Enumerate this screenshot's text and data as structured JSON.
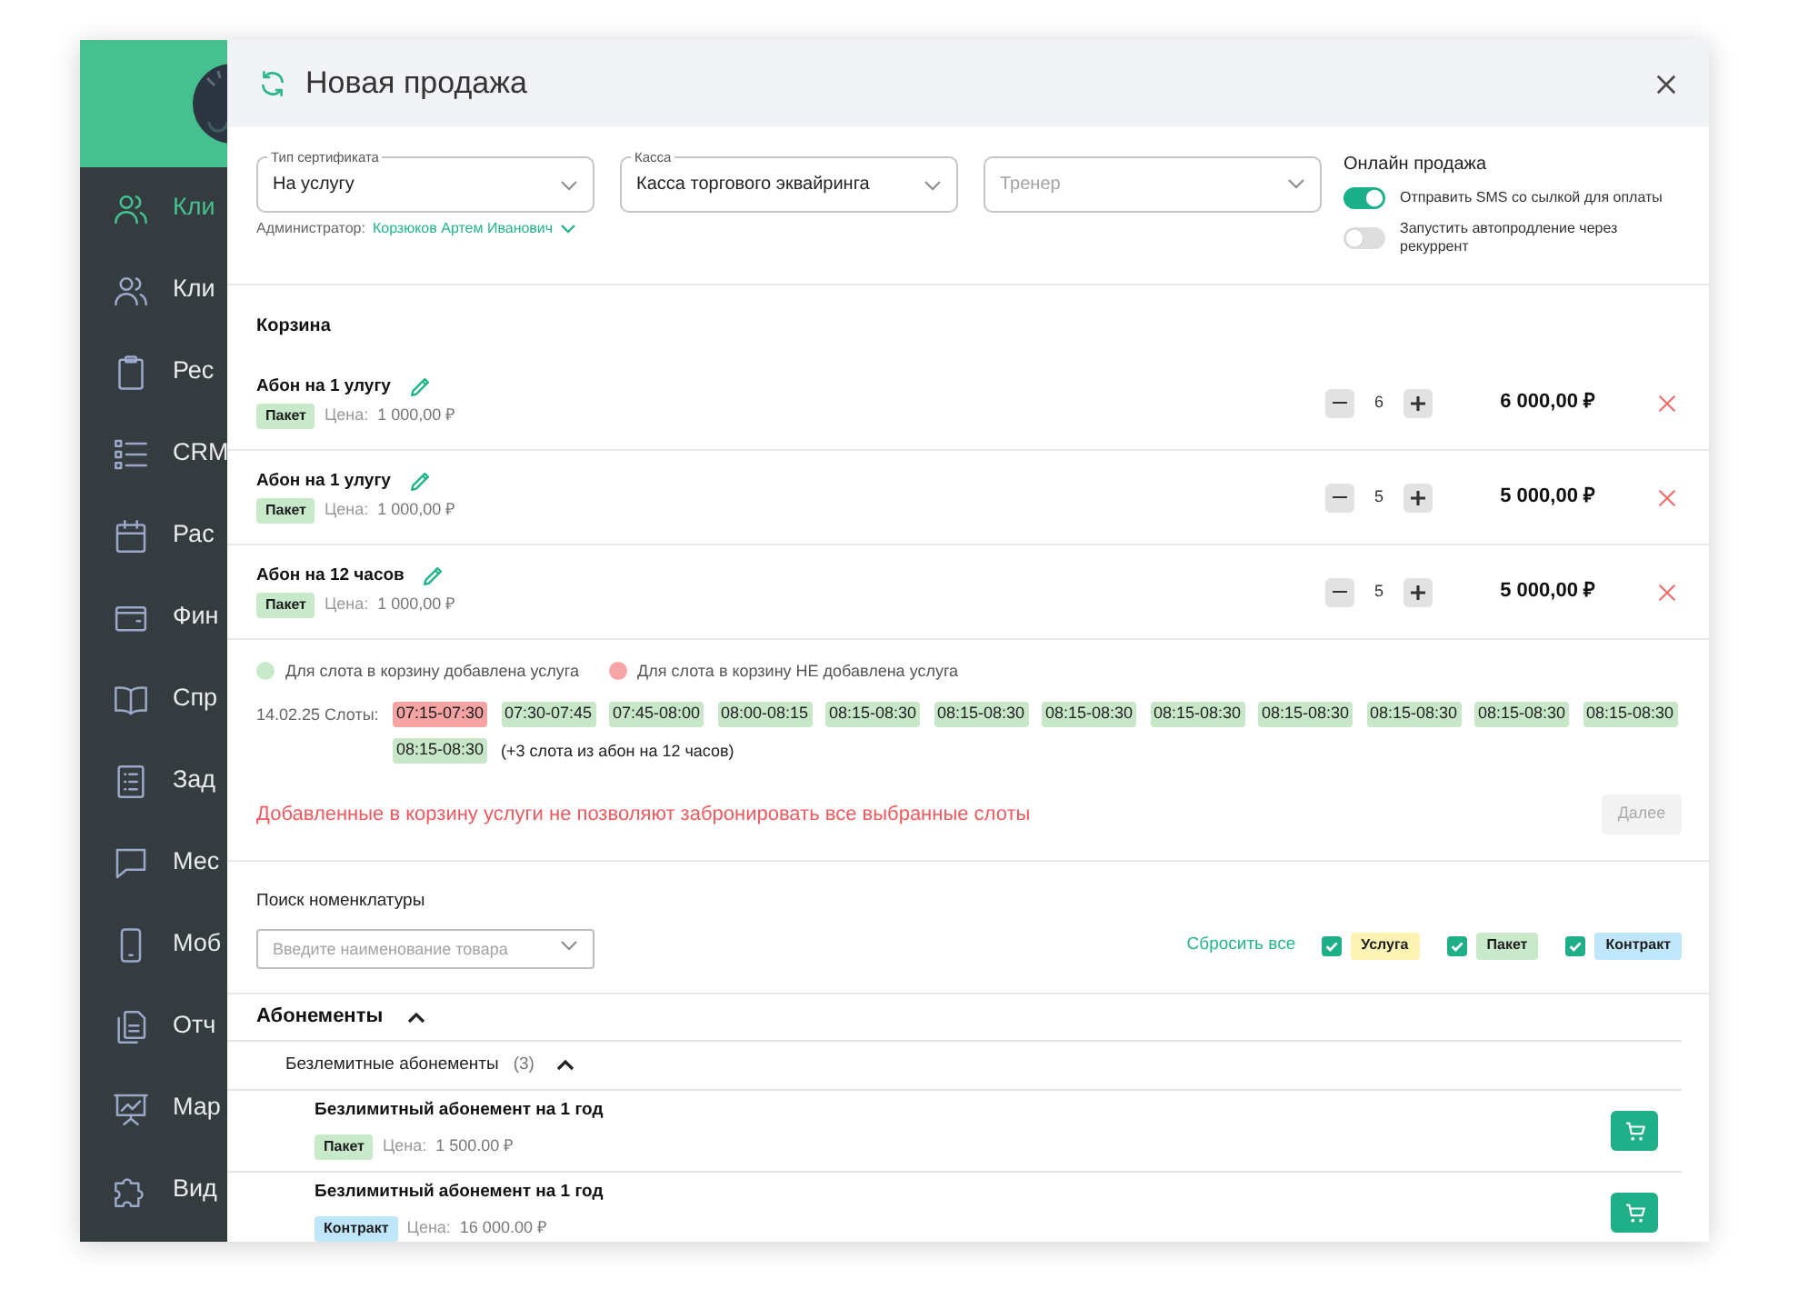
{
  "sidebar": {
    "items": [
      {
        "label": "Кли",
        "selected": true
      },
      {
        "label": "Кли",
        "selected": false
      },
      {
        "label": "Рес",
        "selected": false
      },
      {
        "label": "CRM",
        "selected": false
      },
      {
        "label": "Рас",
        "selected": false
      },
      {
        "label": "Фин",
        "selected": false
      },
      {
        "label": "Спр",
        "selected": false
      },
      {
        "label": "Зад",
        "selected": false
      },
      {
        "label": "Мес",
        "selected": false
      },
      {
        "label": "Моб",
        "selected": false
      },
      {
        "label": "Отч",
        "selected": false
      },
      {
        "label": "Мар",
        "selected": false
      },
      {
        "label": "Вид",
        "selected": false
      }
    ]
  },
  "dialog": {
    "title": "Новая продажа"
  },
  "form": {
    "fields": [
      {
        "label": "Тип сертификата",
        "value": "На услугу"
      },
      {
        "label": "Касса",
        "value": "Касса торгового эквайринга"
      },
      {
        "placeholder": "Тренер"
      }
    ],
    "administrator": {
      "label": "Администратор:",
      "value": "Корзюков Артем Иванович"
    },
    "online_sale": {
      "title": "Онлайн продажа",
      "options": [
        {
          "label": "Отправить SMS со сылкой для оплаты",
          "on": true
        },
        {
          "label": "Запустить автопродление через рекуррент",
          "on": false
        }
      ]
    }
  },
  "cart": {
    "title": "Корзина",
    "items": [
      {
        "name": "Абон на 1 улугу",
        "tag": {
          "label": "Пакет",
          "color": "#c9e9cb"
        },
        "price_label": "Цена:",
        "price": "1 000,00 ₽",
        "quantity": "6",
        "total": "6 000,00 ₽"
      },
      {
        "name": "Абон на 1 улугу",
        "tag": {
          "label": "Пакет",
          "color": "#c9e9cb"
        },
        "price_label": "Цена:",
        "price": "1 000,00 ₽",
        "quantity": "5",
        "total": "5 000,00 ₽"
      },
      {
        "name": "Абон на 12 часов",
        "tag": {
          "label": "Пакет",
          "color": "#c9e9cb"
        },
        "price_label": "Цена:",
        "price": "1 000,00 ₽",
        "quantity": "5",
        "total": "5 000,00 ₽"
      }
    ]
  },
  "slots": {
    "legend": [
      {
        "label": "Для слота в корзину добавлена услуга",
        "color": "#c9e9cb"
      },
      {
        "label": "Для слота в корзину НЕ добавлена услуга",
        "color": "#f7a4a4"
      }
    ],
    "date_label": "14.02.25 Слоты:",
    "items": [
      {
        "time": "07:15-07:30",
        "added": false
      },
      {
        "time": "07:30-07:45",
        "added": true
      },
      {
        "time": "07:45-08:00",
        "added": true
      },
      {
        "time": "08:00-08:15",
        "added": true
      },
      {
        "time": "08:15-08:30",
        "added": true
      },
      {
        "time": "08:15-08:30",
        "added": true
      },
      {
        "time": "08:15-08:30",
        "added": true
      },
      {
        "time": "08:15-08:30",
        "added": true
      },
      {
        "time": "08:15-08:30",
        "added": true
      },
      {
        "time": "08:15-08:30",
        "added": true
      },
      {
        "time": "08:15-08:30",
        "added": true
      },
      {
        "time": "08:15-08:30",
        "added": true
      },
      {
        "time": "08:15-08:30",
        "added": true
      }
    ],
    "note": "(+3 слота из абон на 12 часов)",
    "error": "Добавленные в корзину услуги не позволяют забронировать все выбранные слоты",
    "next_button": {
      "label": "Далее",
      "disabled": true
    }
  },
  "catalog": {
    "search": {
      "label": "Поиск номенклатуры",
      "placeholder": "Введите наименование товара"
    },
    "reset": "Сбросить все",
    "filters": [
      {
        "label": "Услуга",
        "checked": true,
        "color": "#fdf3b3"
      },
      {
        "label": "Пакет",
        "checked": true,
        "color": "#c9e9cb"
      },
      {
        "label": "Контракт",
        "checked": true,
        "color": "#bfe6fb"
      }
    ],
    "groups": [
      {
        "title": "Абонементы",
        "expanded": true,
        "children": [
          {
            "title": "Безлемитные абонементы",
            "count": "(3)",
            "expanded": true,
            "children": [
              {
                "name": "Безлимитный абонемент на 1 год",
                "tag": {
                  "label": "Пакет",
                  "color": "#c9e9cb"
                },
                "price_label": "Цена:",
                "price": "1 500.00 ₽"
              },
              {
                "name": "Безлимитный абонемент на 1 год",
                "tag": {
                  "label": "Контракт",
                  "color": "#bfe6fb"
                },
                "price_label": "Цена:",
                "price": "16 000.00 ₽"
              }
            ]
          }
        ]
      }
    ]
  }
}
